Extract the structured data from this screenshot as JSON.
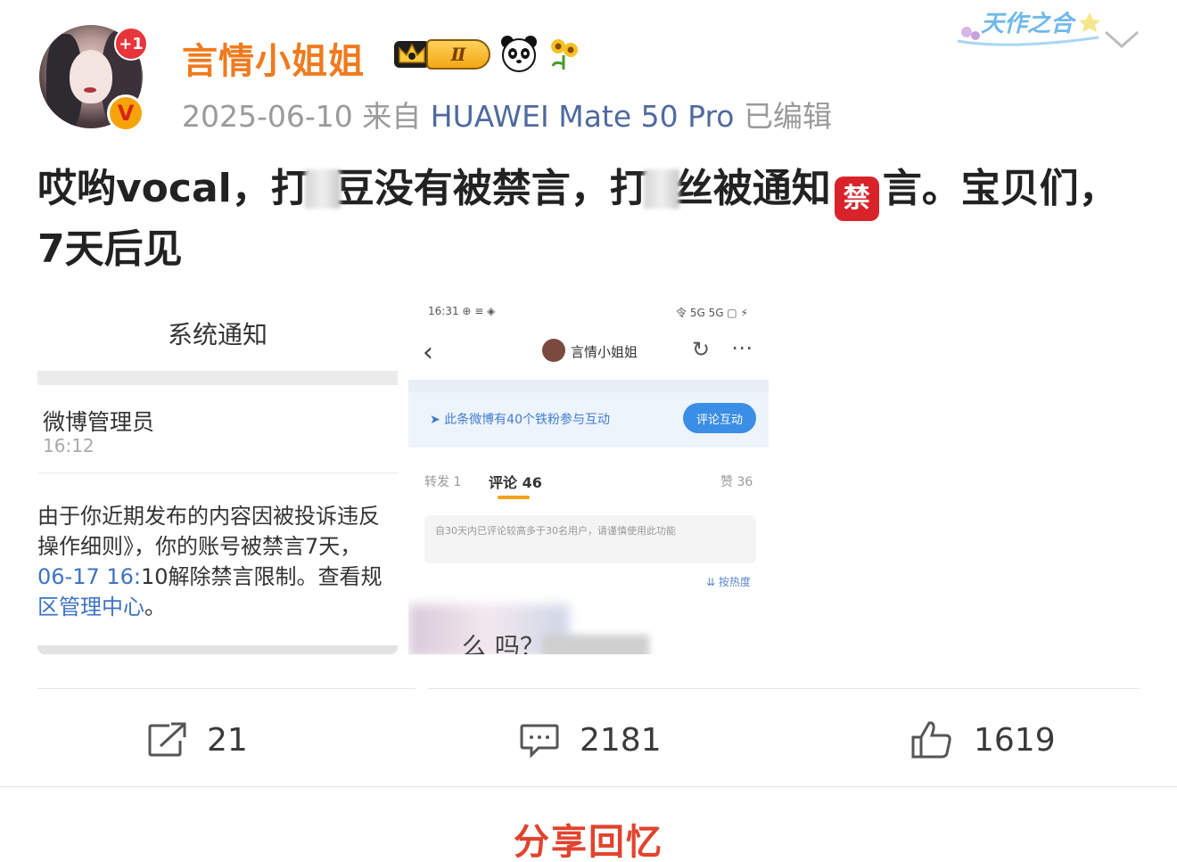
{
  "post": {
    "username": "言情小姐姐",
    "level_badge": "Ⅱ",
    "avatar_badge": "+1",
    "verified_badge": "V",
    "decoration_text": "天作之合",
    "date": "2025-06-10",
    "from_label": "来自",
    "device": "HUAWEI Mate 50 Pro",
    "edited_label": "已编辑",
    "text_part1": "哎哟vocal，打",
    "text_part2": "豆没有被禁言，打",
    "text_part3": "丝被通知",
    "ban_emoji": "禁",
    "text_part4": "言。宝贝们，7天后见"
  },
  "image1": {
    "title": "系统通知",
    "sender": "微博管理员",
    "time": "16:12",
    "body_line1": "由于你近期发布的内容因被投诉违反",
    "body_line2": "操作细则》，你的账号被禁言7天，",
    "body_line3_link": "06-17 16:",
    "body_line3_rest": "10解除禁言限制。查看规",
    "body_line4_link": "区管理中心",
    "body_line4_rest": "。"
  },
  "image2": {
    "status_left": "16:31 ⊕ ≡ ◈",
    "status_right": "令 5G 5G ▢ ⚡",
    "back_icon": "‹",
    "author": "言情小姐姐",
    "fan_text": "➤  此条微博有40个铁粉参与互动",
    "fan_button": "评论互动",
    "tab_forward": "转发 1",
    "tab_comment": "评论 46",
    "tab_like": "赞 36",
    "notice": "自30天内已评论较高多于30名用户，请谨慎使用此功能",
    "fold": "⇊ 按热度",
    "comment_fragment": "么      吗？"
  },
  "actions": {
    "repost_count": "21",
    "comment_count": "2181",
    "like_count": "1619"
  },
  "share_label": "分享回忆",
  "colors": {
    "username": "#f07a1e",
    "device_link": "#4f6a9e",
    "share": "#e2432e",
    "ban_emoji_bg": "#d8232a"
  }
}
